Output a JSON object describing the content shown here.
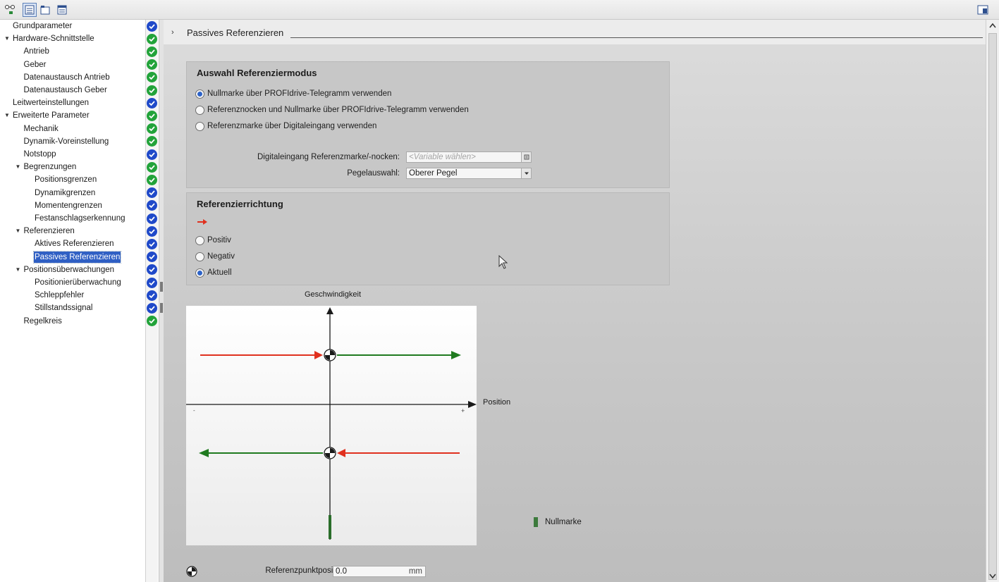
{
  "nav": {
    "items": [
      {
        "label": "Grundparameter",
        "level": 0,
        "toggle": "",
        "status": "blue"
      },
      {
        "label": "Hardware-Schnittstelle",
        "level": 0,
        "toggle": "▼",
        "status": "green"
      },
      {
        "label": "Antrieb",
        "level": 1,
        "toggle": "",
        "status": "green"
      },
      {
        "label": "Geber",
        "level": 1,
        "toggle": "",
        "status": "green"
      },
      {
        "label": "Datenaustausch Antrieb",
        "level": 1,
        "toggle": "",
        "status": "green"
      },
      {
        "label": "Datenaustausch Geber",
        "level": 1,
        "toggle": "",
        "status": "green"
      },
      {
        "label": "Leitwerteinstellungen",
        "level": 0,
        "toggle": "",
        "status": "blue"
      },
      {
        "label": "Erweiterte Parameter",
        "level": 0,
        "toggle": "▼",
        "status": "green"
      },
      {
        "label": "Mechanik",
        "level": 1,
        "toggle": "",
        "status": "green"
      },
      {
        "label": "Dynamik-Voreinstellung",
        "level": 1,
        "toggle": "",
        "status": "green"
      },
      {
        "label": "Notstopp",
        "level": 1,
        "toggle": "",
        "status": "blue"
      },
      {
        "label": "Begrenzungen",
        "level": 1,
        "toggle": "▼",
        "status": "green"
      },
      {
        "label": "Positionsgrenzen",
        "level": 2,
        "toggle": "",
        "status": "green"
      },
      {
        "label": "Dynamikgrenzen",
        "level": 2,
        "toggle": "",
        "status": "blue"
      },
      {
        "label": "Momentengrenzen",
        "level": 2,
        "toggle": "",
        "status": "blue"
      },
      {
        "label": "Festanschlagserkennung",
        "level": 2,
        "toggle": "",
        "status": "blue"
      },
      {
        "label": "Referenzieren",
        "level": 1,
        "toggle": "▼",
        "status": "blue"
      },
      {
        "label": "Aktives Referenzieren",
        "level": 2,
        "toggle": "",
        "status": "blue"
      },
      {
        "label": "Passives Referenzieren",
        "level": 2,
        "toggle": "",
        "status": "blue",
        "selected": true
      },
      {
        "label": "Positionsüberwachungen",
        "level": 1,
        "toggle": "▼",
        "status": "blue"
      },
      {
        "label": "Positionierüberwachung",
        "level": 2,
        "toggle": "",
        "status": "blue"
      },
      {
        "label": "Schleppfehler",
        "level": 2,
        "toggle": "",
        "status": "blue"
      },
      {
        "label": "Stillstandssignal",
        "level": 2,
        "toggle": "",
        "status": "blue"
      },
      {
        "label": "Regelkreis",
        "level": 1,
        "toggle": "",
        "status": "green"
      }
    ]
  },
  "section": {
    "title": "Passives Referenzieren"
  },
  "mode_group": {
    "title": "Auswahl Referenziermodus",
    "options": [
      {
        "label": "Nullmarke über PROFIdrive-Telegramm verwenden",
        "checked": true
      },
      {
        "label": "Referenznocken und Nullmarke über PROFIdrive-Telegramm verwenden",
        "checked": false
      },
      {
        "label": "Referenzmarke über Digitaleingang verwenden",
        "checked": false
      }
    ],
    "digital_input": {
      "label": "Digitaleingang Referenzmarke/-nocken:",
      "placeholder": "<Variable wählen>"
    },
    "level_select": {
      "label": "Pegelauswahl:",
      "value": "Oberer Pegel"
    }
  },
  "direction_group": {
    "title": "Referenzierrichtung",
    "options": [
      {
        "label": "Positiv",
        "checked": false
      },
      {
        "label": "Negativ",
        "checked": false
      },
      {
        "label": "Aktuell",
        "checked": true
      }
    ]
  },
  "diagram": {
    "y_label": "Geschwindigkeit",
    "x_label": "Position",
    "minus_label": "-",
    "plus_label": "+",
    "legend_label": "Nullmarke",
    "colors": {
      "approach": "#e0301e",
      "return": "#1f7a1f",
      "nullmarke": "#3c7a3c",
      "axis": "#1a1a1a"
    }
  },
  "ref_point": {
    "label": "Referenzpunktposition:",
    "value": "0.0",
    "unit": "mm"
  }
}
